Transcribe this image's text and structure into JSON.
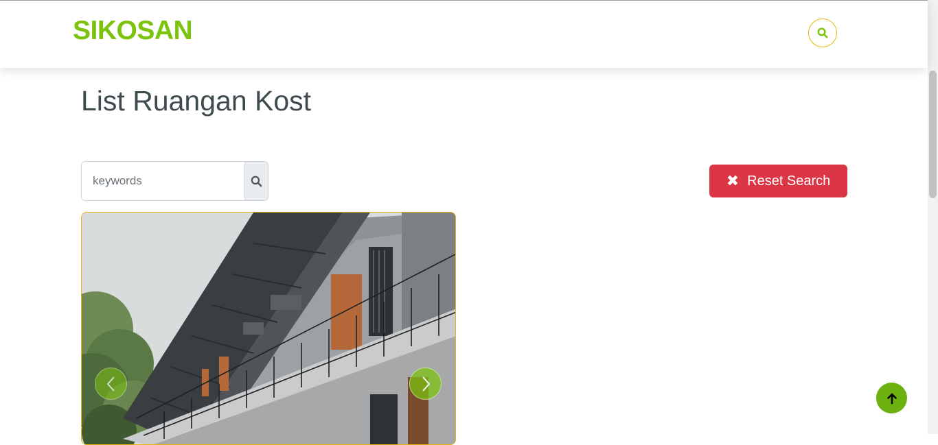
{
  "header": {
    "brand": "SIKOSAN",
    "search_icon": "search-icon"
  },
  "main": {
    "title": "List Ruangan Kost",
    "search": {
      "placeholder": "keywords",
      "value": "",
      "button_icon": "search-icon"
    },
    "reset_button": {
      "icon": "close-icon",
      "label": "Reset Search"
    },
    "card": {
      "image": "boarding-house-building-photo",
      "prev_icon": "chevron-left-icon",
      "next_icon": "chevron-right-icon"
    }
  },
  "back_to_top": {
    "icon": "arrow-up-icon"
  },
  "colors": {
    "brand": "#7cc30e",
    "accent_border": "#e8b70a",
    "danger": "#dc3545",
    "title": "#3d4a4e"
  }
}
